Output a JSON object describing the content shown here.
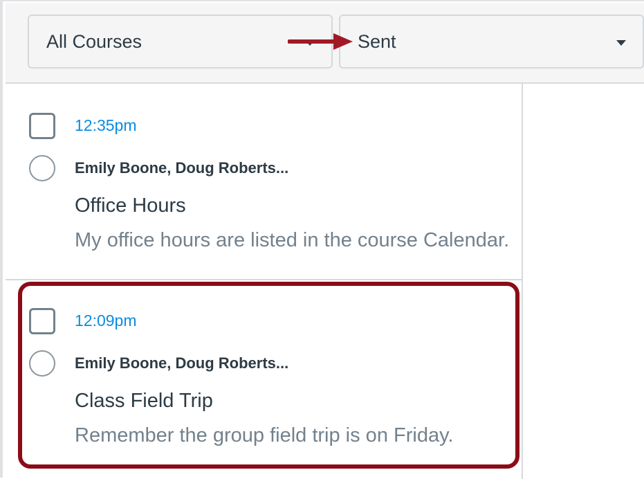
{
  "filters": {
    "course_select": {
      "value": "All Courses",
      "icon": "chevron-down-icon"
    },
    "mailbox_select": {
      "value": "Sent",
      "icon": "chevron-down-icon"
    }
  },
  "annotation": {
    "arrow_color": "#a01925",
    "box_color": "#8b0c17"
  },
  "messages": [
    {
      "time": "12:35pm",
      "participants": "Emily Boone, Doug Roberts...",
      "subject": "Office Hours",
      "preview": "My office hours are listed in the course Calendar."
    },
    {
      "time": "12:09pm",
      "participants": "Emily Boone, Doug Roberts...",
      "subject": "Class Field Trip",
      "preview": "Remember the group field trip is on Friday."
    }
  ],
  "colors": {
    "time_link": "#0b8ce0",
    "text_primary": "#2d3b45",
    "text_secondary": "#73818c",
    "toolbar_bg": "#f5f5f5"
  }
}
